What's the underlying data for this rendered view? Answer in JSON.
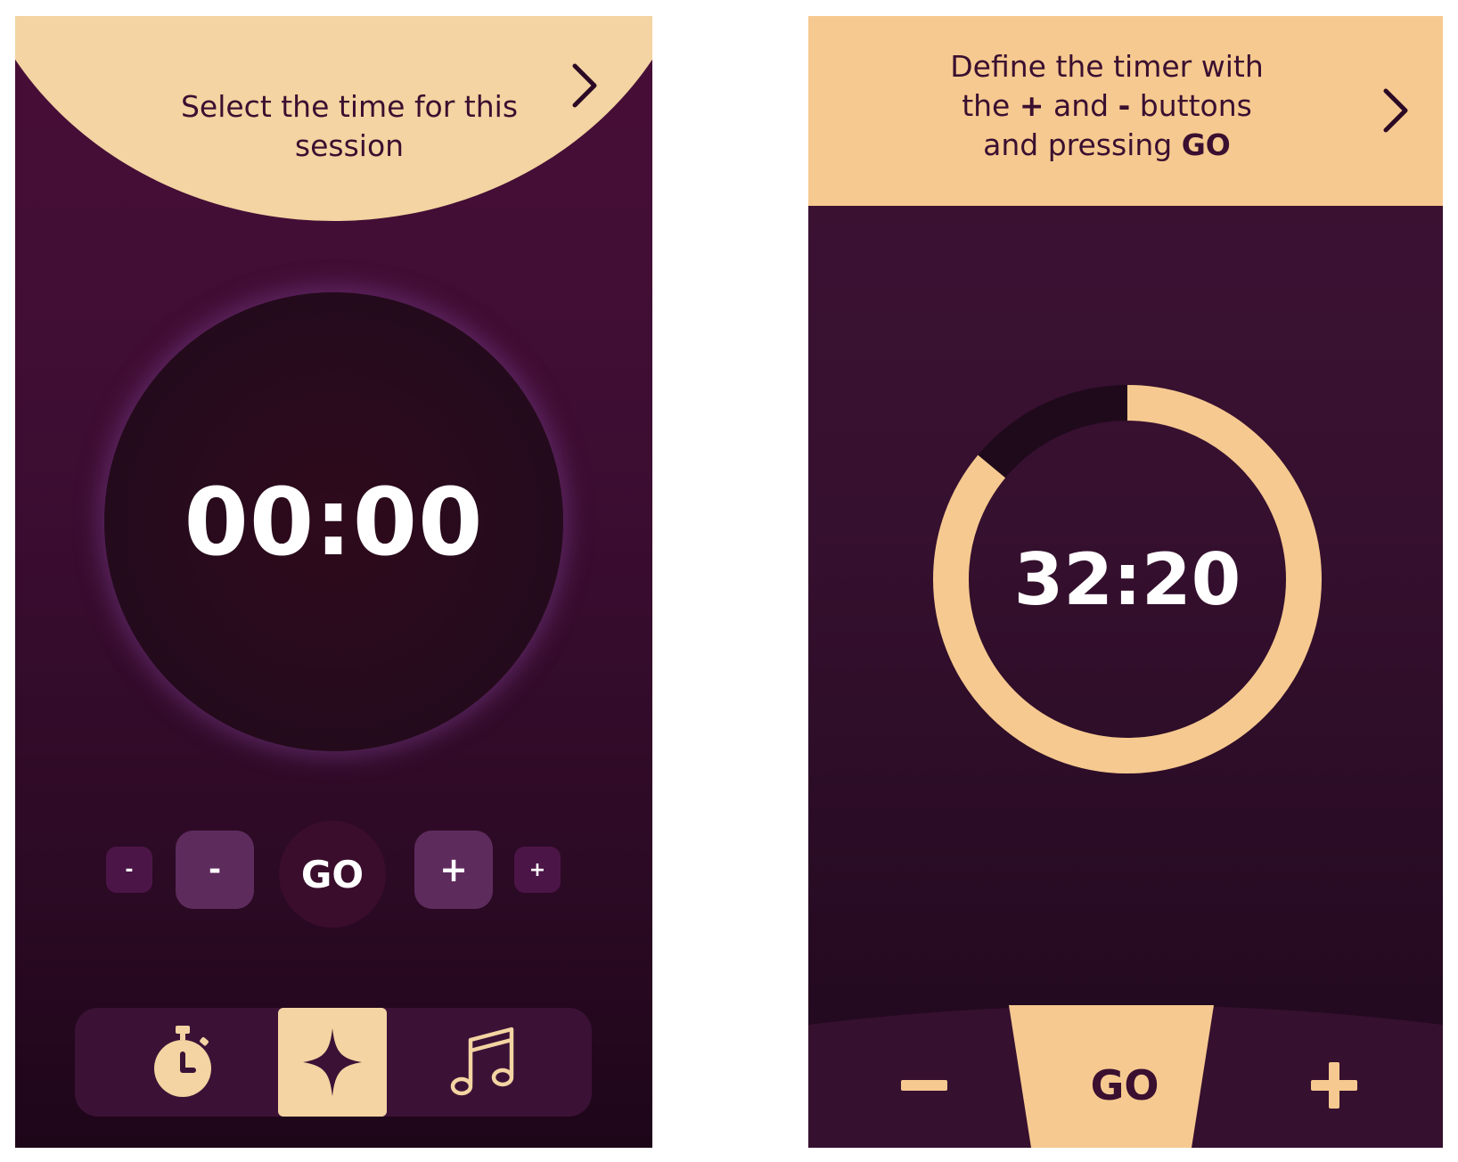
{
  "colors": {
    "accent": "#f3d4a2",
    "accent_b": "#f6c990",
    "background_dark": "#3d0d32",
    "ring_track": "#1f0a1b"
  },
  "screen_a": {
    "header": "Select the time for this session",
    "next_icon": "chevron-right-icon",
    "timer_display": "00:00",
    "controls": {
      "minus_small": "-",
      "minus_big": "-",
      "go": "GO",
      "plus_big": "+",
      "plus_small": "+"
    },
    "nav": [
      {
        "icon": "stopwatch-icon"
      },
      {
        "icon": "sparkle-icon",
        "selected": true
      },
      {
        "icon": "music-note-icon"
      }
    ]
  },
  "screen_b": {
    "header_parts": {
      "line1": "Define the timer with",
      "line2_pre": "the ",
      "plus": "+",
      "line2_mid": " and ",
      "minus": "-",
      "line2_post": " buttons",
      "line3_pre": "and pressing ",
      "go": "GO"
    },
    "next_icon": "chevron-right-icon",
    "timer_display": "32:20",
    "progress_fraction": 0.86,
    "controls": {
      "go": "GO",
      "minus_icon": "minus-icon",
      "plus_icon": "plus-icon"
    }
  }
}
